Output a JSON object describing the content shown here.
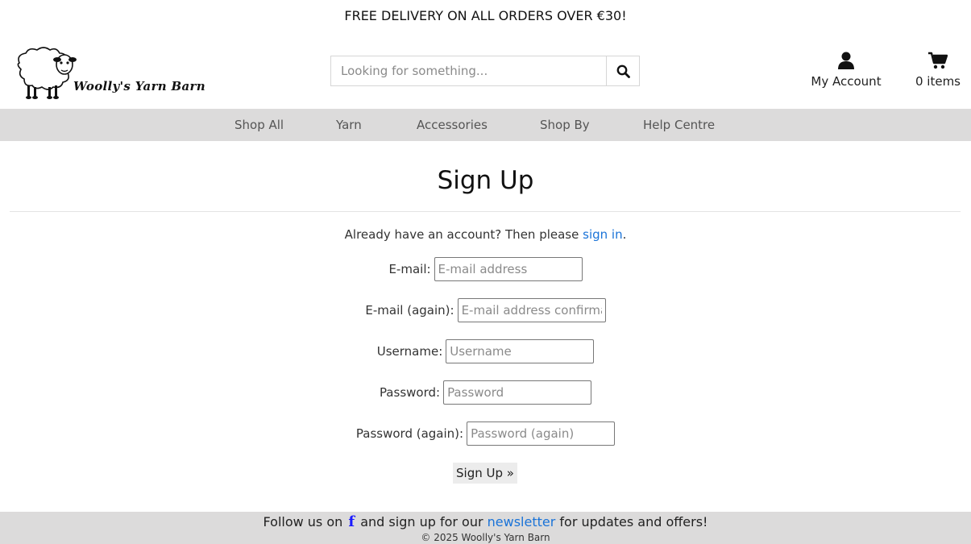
{
  "banner": {
    "text": "FREE DELIVERY ON ALL ORDERS OVER €30!"
  },
  "header": {
    "logo_text": "Woolly's Yarn Barn",
    "search_placeholder": "Looking for something...",
    "account_label": "My Account",
    "cart_label": "0 items"
  },
  "nav": {
    "items": [
      {
        "label": "Shop All"
      },
      {
        "label": "Yarn"
      },
      {
        "label": "Accessories"
      },
      {
        "label": "Shop By"
      },
      {
        "label": "Help Centre"
      }
    ]
  },
  "main": {
    "title": "Sign Up",
    "signin_prefix": "Already have an account? Then please ",
    "signin_link": "sign in",
    "signin_suffix": "."
  },
  "form": {
    "fields": [
      {
        "label": "E-mail:",
        "placeholder": "E-mail address"
      },
      {
        "label": "E-mail (again):",
        "placeholder": "E-mail address confirmation"
      },
      {
        "label": "Username:",
        "placeholder": "Username"
      },
      {
        "label": "Password:",
        "placeholder": "Password"
      },
      {
        "label": "Password (again):",
        "placeholder": "Password (again)"
      }
    ],
    "submit_label": "Sign Up »"
  },
  "footer": {
    "prefix": "Follow us on",
    "facebook_glyph": "f",
    "middle": "and sign up for our",
    "newsletter_link": "newsletter",
    "suffix": "for updates and offers!",
    "copyright": "© 2025 Woolly's Yarn Barn"
  },
  "colors": {
    "nav_bg": "#dcdbdb",
    "link": "#1a73d8",
    "facebook": "#1a1aff"
  },
  "icons": [
    "sheep-logo-icon",
    "search-icon",
    "user-icon",
    "cart-icon",
    "facebook-icon"
  ]
}
